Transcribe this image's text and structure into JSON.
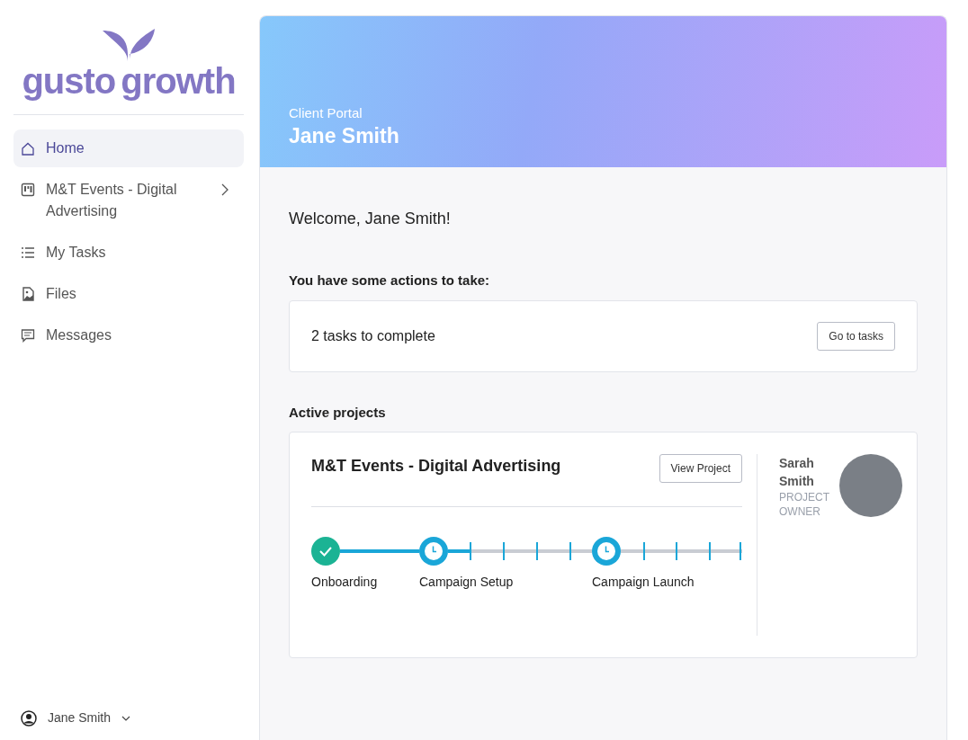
{
  "logo": {
    "word_1": "gusto",
    "word_2": "growth"
  },
  "sidebar": {
    "items": [
      {
        "label": "Home",
        "selected": true,
        "expandable": false
      },
      {
        "label": "M&T Events - Digital Advertising",
        "selected": false,
        "expandable": true
      },
      {
        "label": "My Tasks",
        "selected": false,
        "expandable": false
      },
      {
        "label": "Files",
        "selected": false,
        "expandable": false
      },
      {
        "label": "Messages",
        "selected": false,
        "expandable": false
      }
    ],
    "user": "Jane Smith"
  },
  "banner": {
    "subtitle": "Client Portal",
    "title": "Jane Smith"
  },
  "welcome": "Welcome, Jane Smith!",
  "actions": {
    "heading": "You have some actions to take:",
    "text": "2 tasks to complete",
    "button": "Go to tasks"
  },
  "projects": {
    "heading": "Active projects",
    "items": [
      {
        "title": "M&T Events - Digital Advertising",
        "button": "View Project",
        "timeline": {
          "stages": [
            {
              "label": "Onboarding",
              "kind": "complete"
            },
            {
              "label": "Campaign Setup",
              "kind": "pending"
            },
            {
              "label": "Campaign Launch",
              "kind": "pending"
            }
          ]
        },
        "owner": {
          "first_name": "Sarah",
          "last_name": "Smith",
          "role": "PROJECT OWNER"
        }
      }
    ]
  }
}
